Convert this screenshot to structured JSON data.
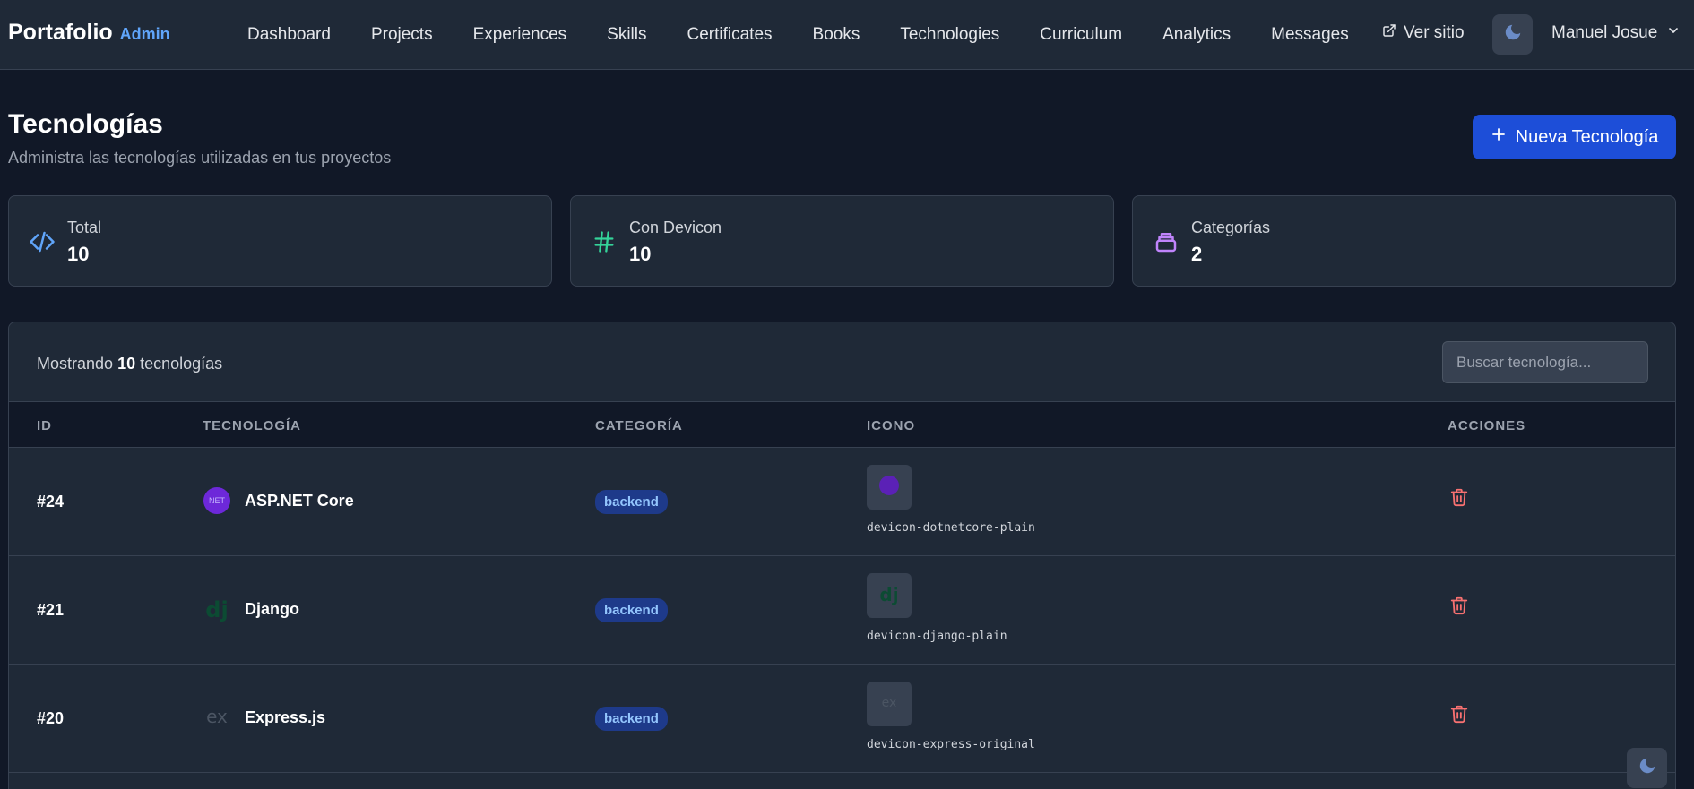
{
  "brand": {
    "name": "Portafolio",
    "suffix": "Admin"
  },
  "nav": {
    "links": [
      "Dashboard",
      "Projects",
      "Experiences",
      "Skills",
      "Certificates",
      "Books",
      "Technologies",
      "Curriculum",
      "Analytics",
      "Messages"
    ],
    "view_site": "Ver sitio",
    "user_name": "Manuel Josue"
  },
  "header": {
    "title": "Tecnologías",
    "subtitle": "Administra las tecnologías utilizadas en tus proyectos",
    "new_button": "Nueva Tecnología"
  },
  "stats": [
    {
      "label": "Total",
      "value": "10",
      "icon": "code-icon",
      "color": "#60a5fa"
    },
    {
      "label": "Con Devicon",
      "value": "10",
      "icon": "hashtag-icon",
      "color": "#34d399"
    },
    {
      "label": "Categorías",
      "value": "2",
      "icon": "layers-icon",
      "color": "#c084fc"
    }
  ],
  "table": {
    "showing_prefix": "Mostrando",
    "showing_count": "10",
    "showing_suffix": "tecnologías",
    "search_placeholder": "Buscar tecnología...",
    "columns": [
      "ID",
      "TECNOLOGÍA",
      "CATEGORÍA",
      "ICONO",
      "ACCIONES"
    ],
    "rows": [
      {
        "id": "#24",
        "name": "ASP.NET Core",
        "category": "backend",
        "icon_class": "devicon-dotnetcore-plain",
        "logo": "dotnet-icon",
        "logo_color": "#7c3aed"
      },
      {
        "id": "#21",
        "name": "Django",
        "category": "backend",
        "icon_class": "devicon-django-plain",
        "logo": "django-icon",
        "logo_color": "#0c4b33"
      },
      {
        "id": "#20",
        "name": "Express.js",
        "category": "backend",
        "icon_class": "devicon-express-original",
        "logo": "express-icon",
        "logo_color": "#4b5563"
      }
    ]
  },
  "colors": {
    "accent": "#1d4ed8",
    "brand_sub": "#60a5fa",
    "danger": "#f87171",
    "background": "#111827",
    "surface": "#1f2937"
  }
}
